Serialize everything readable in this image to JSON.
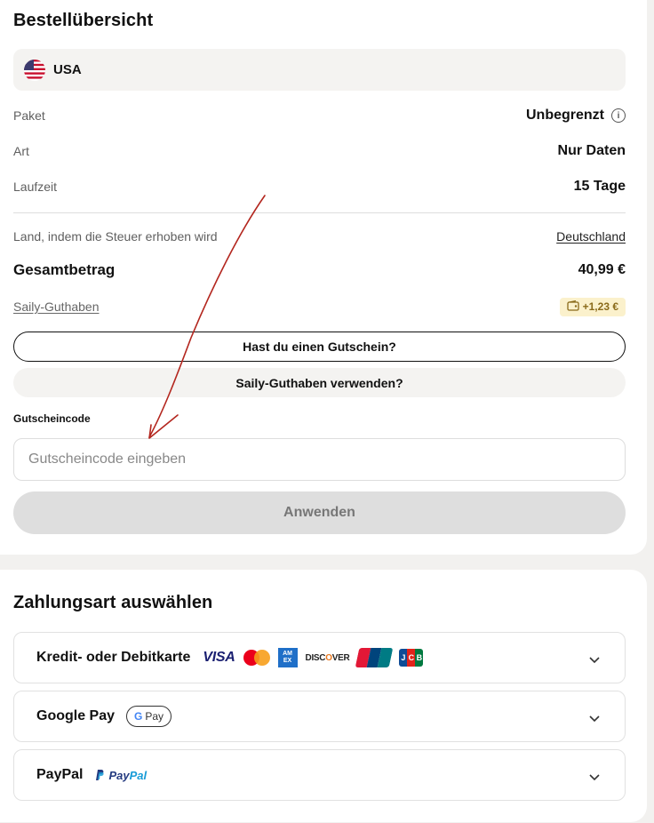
{
  "summary": {
    "title": "Bestellübersicht",
    "country": "USA",
    "rows": [
      {
        "label": "Paket",
        "value": "Unbegrenzt"
      },
      {
        "label": "Art",
        "value": "Nur Daten"
      },
      {
        "label": "Laufzeit",
        "value": "15 Tage"
      }
    ],
    "tax_label": "Land, indem die Steuer erhoben wird",
    "tax_value": "Deutschland",
    "total_label": "Gesamtbetrag",
    "total_value": "40,99 €",
    "credit_label": "Saily-Guthaben",
    "credit_value": "+1,23 €",
    "voucher_button": "Hast du einen Gutschein?",
    "credit_button": "Saily-Guthaben verwenden?",
    "voucher_field_label": "Gutscheincode",
    "voucher_placeholder": "Gutscheincode eingeben",
    "apply_button": "Anwenden"
  },
  "payment": {
    "title": "Zahlungsart auswählen",
    "methods": [
      {
        "label": "Kredit- oder Debitkarte",
        "logos": [
          "VISA",
          "Mastercard",
          "AMEX",
          "DISCOVER",
          "UnionPay",
          "JCB"
        ]
      },
      {
        "label": "Google Pay",
        "badge": "Pay"
      },
      {
        "label": "PayPal",
        "badge_1": "Pay",
        "badge_2": "Pal"
      }
    ]
  },
  "logo_text": {
    "visa": "VISA",
    "amex": "AM EX",
    "discover_a": "DISC",
    "discover_b": "O",
    "discover_c": "VER",
    "jcb": [
      "J",
      "C",
      "B"
    ],
    "gpay_g": "G"
  },
  "colors": {
    "accent_arrow": "#b3261e",
    "credit_badge_bg": "#fbf1cc",
    "apply_disabled_bg": "#dedede"
  }
}
